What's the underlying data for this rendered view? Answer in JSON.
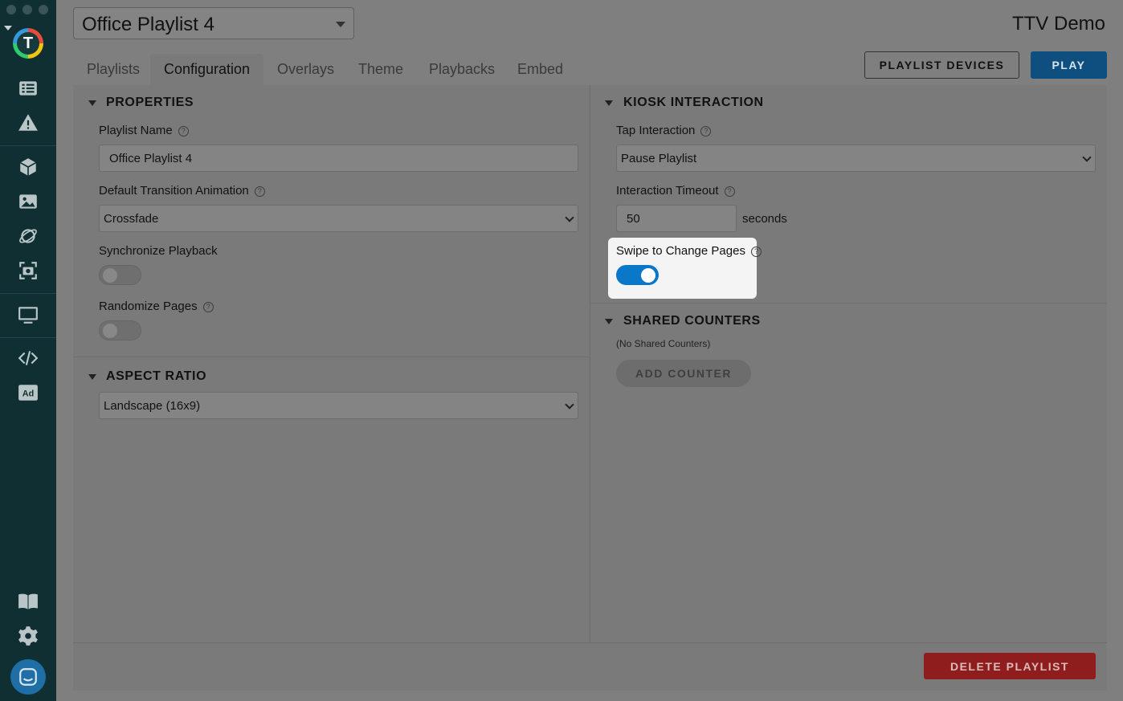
{
  "header": {
    "playlist_selected": "Office Playlist 4",
    "org_name": "TTV Demo",
    "buttons": {
      "devices": "PLAYLIST DEVICES",
      "play": "PLAY"
    }
  },
  "tabs": [
    {
      "label": "Playlists",
      "active": false
    },
    {
      "label": "Configuration",
      "active": true
    },
    {
      "label": "Overlays",
      "active": false
    },
    {
      "label": "Theme",
      "active": false
    },
    {
      "label": "Playbacks",
      "active": false
    },
    {
      "label": "Embed",
      "active": false
    }
  ],
  "sidebar": {
    "logo_letter": "T",
    "icons": [
      "list-icon",
      "alert-icon",
      "cube-icon",
      "image-icon",
      "satellite-icon",
      "camera-icon",
      "monitor-icon",
      "code-icon",
      "ad-icon",
      "book-icon",
      "gear-icon",
      "chat-icon"
    ]
  },
  "properties": {
    "title": "PROPERTIES",
    "playlist_name_label": "Playlist Name",
    "playlist_name_value": "Office Playlist 4",
    "transition_label": "Default Transition Animation",
    "transition_value": "Crossfade",
    "sync_label": "Synchronize Playback",
    "sync_on": false,
    "randomize_label": "Randomize Pages",
    "randomize_on": false
  },
  "aspect_ratio": {
    "title": "ASPECT RATIO",
    "value": "Landscape (16x9)"
  },
  "kiosk": {
    "title": "KIOSK INTERACTION",
    "tap_label": "Tap Interaction",
    "tap_value": "Pause Playlist",
    "timeout_label": "Interaction Timeout",
    "timeout_value": "50",
    "timeout_unit": "seconds",
    "swipe_label": "Swipe to Change Pages",
    "swipe_on": true
  },
  "shared_counters": {
    "title": "SHARED COUNTERS",
    "empty_text": "(No Shared Counters)",
    "add_button": "ADD COUNTER"
  },
  "footer": {
    "delete_button": "DELETE PLAYLIST"
  },
  "help_glyph": "?",
  "colors": {
    "primary": "#0a77c8",
    "danger": "#8f1d1d",
    "sidebar": "#0f2f33"
  }
}
